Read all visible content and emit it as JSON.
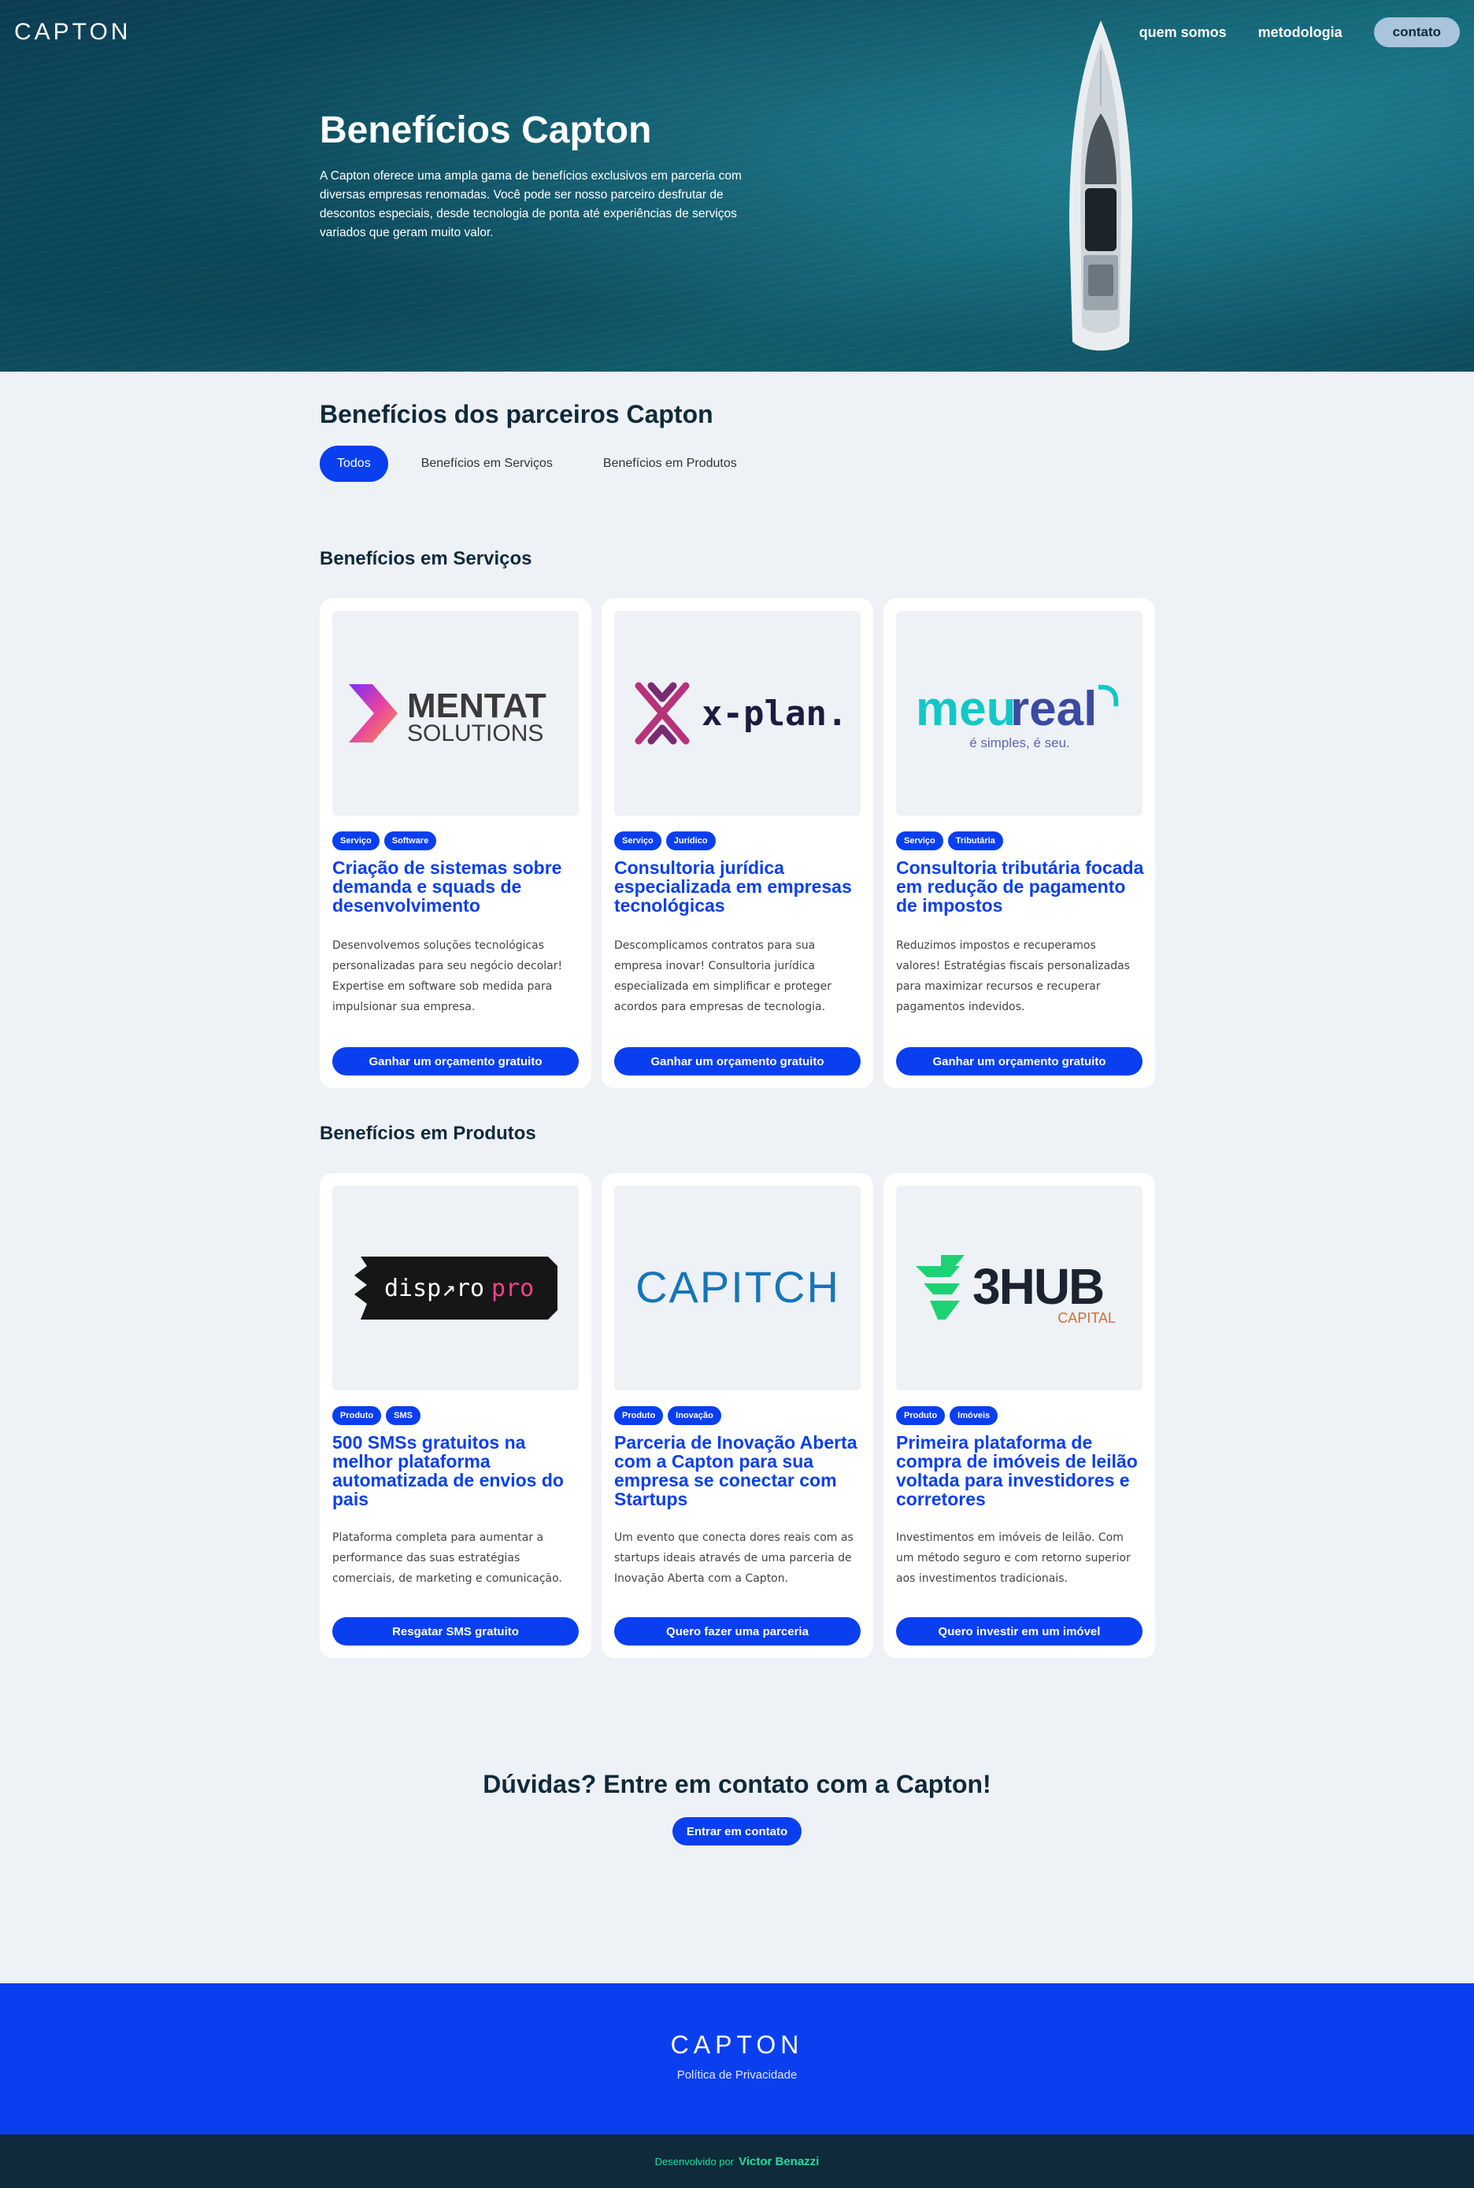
{
  "header": {
    "logo": "CAPTON",
    "nav": [
      "quem somos",
      "metodologia"
    ],
    "contact": "contato"
  },
  "hero": {
    "title": "Benefícios Capton",
    "text": "A Capton oferece uma ampla gama de benefícios exclusivos em parceria com diversas empresas renomadas. Você pode ser nosso parceiro desfrutar de descontos especiais, desde tecnologia de ponta até experiências de serviços variados que geram muito valor."
  },
  "partners": {
    "title": "Benefícios dos parceiros Capton",
    "filters": [
      "Todos",
      "Benefícios em Serviços",
      "Benefícios em Produtos"
    ]
  },
  "services": {
    "title": "Benefícios em Serviços",
    "cards": [
      {
        "logo_main": "MENTAT",
        "logo_sub": "SOLUTIONS",
        "tags": [
          "Serviço",
          "Software"
        ],
        "title": "Criação de sistemas sobre demanda e squads de desenvolvimento",
        "text": "Desenvolvemos soluções tecnológicas personalizadas para seu negócio decolar! Expertise em software sob medida para impulsionar sua empresa.",
        "button": "Ganhar um orçamento gratuito"
      },
      {
        "logo_main": "x-plan.",
        "tags": [
          "Serviço",
          "Jurídico"
        ],
        "title": "Consultoria jurídica especializada em empresas tecnológicas",
        "text": "Descomplicamos contratos para sua empresa inovar! Consultoria jurídica especializada em simplificar e proteger acordos para empresas de tecnologia.",
        "button": "Ganhar um orçamento gratuito"
      },
      {
        "logo_main_a": "meu",
        "logo_main_b": "real",
        "logo_sub": "é simples, é seu.",
        "tags": [
          "Serviço",
          "Tributária"
        ],
        "title": "Consultoria tributária focada em redução de pagamento de impostos",
        "text": "Reduzimos impostos e recuperamos valores! Estratégias fiscais personalizadas para maximizar recursos e recuperar pagamentos indevidos.",
        "button": "Ganhar um orçamento gratuito"
      }
    ]
  },
  "products": {
    "title": "Benefícios em Produtos",
    "cards": [
      {
        "logo_main_a": "disp",
        "logo_main_b": "ro",
        "logo_main_c": "pro",
        "tags": [
          "Produto",
          "SMS"
        ],
        "title": "500 SMSs gratuitos na melhor plataforma automatizada de envios do pais",
        "text": "Plataforma completa para aumentar a performance das suas estratégias comerciais, de marketing e comunicação.",
        "button": "Resgatar SMS gratuito"
      },
      {
        "logo_main": "CAPITCH",
        "tags": [
          "Produto",
          "Inovação"
        ],
        "title": "Parceria de Inovação Aberta com a Capton para sua empresa se conectar com Startups",
        "text": "Um evento que conecta dores reais com as startups ideais através de uma parceria de Inovação Aberta com a Capton.",
        "button": "Quero fazer uma parceria"
      },
      {
        "logo_main": "3HUB",
        "logo_sub": "CAPITAL",
        "tags": [
          "Produto",
          "Imóveis"
        ],
        "title": "Primeira plataforma de compra de imóveis de leilão voltada para investidores e corretores",
        "text": "Investimentos em imóveis de leilão. Com um método seguro e com retorno superior aos investimentos tradicionais.",
        "button": "Quero investir em um imóvel"
      }
    ]
  },
  "cta": {
    "title": "Dúvidas? Entre em contato com a Capton!",
    "button": "Entrar em contato"
  },
  "footer": {
    "logo": "CAPTON",
    "link": "Política de Privacidade",
    "credit_prefix": "Desenvolvido por",
    "credit_name": "Victor Benazzi"
  },
  "colors": {
    "accent": "#0a3ff0",
    "dark": "#0f2a3a",
    "credit": "#1fdf9c"
  }
}
